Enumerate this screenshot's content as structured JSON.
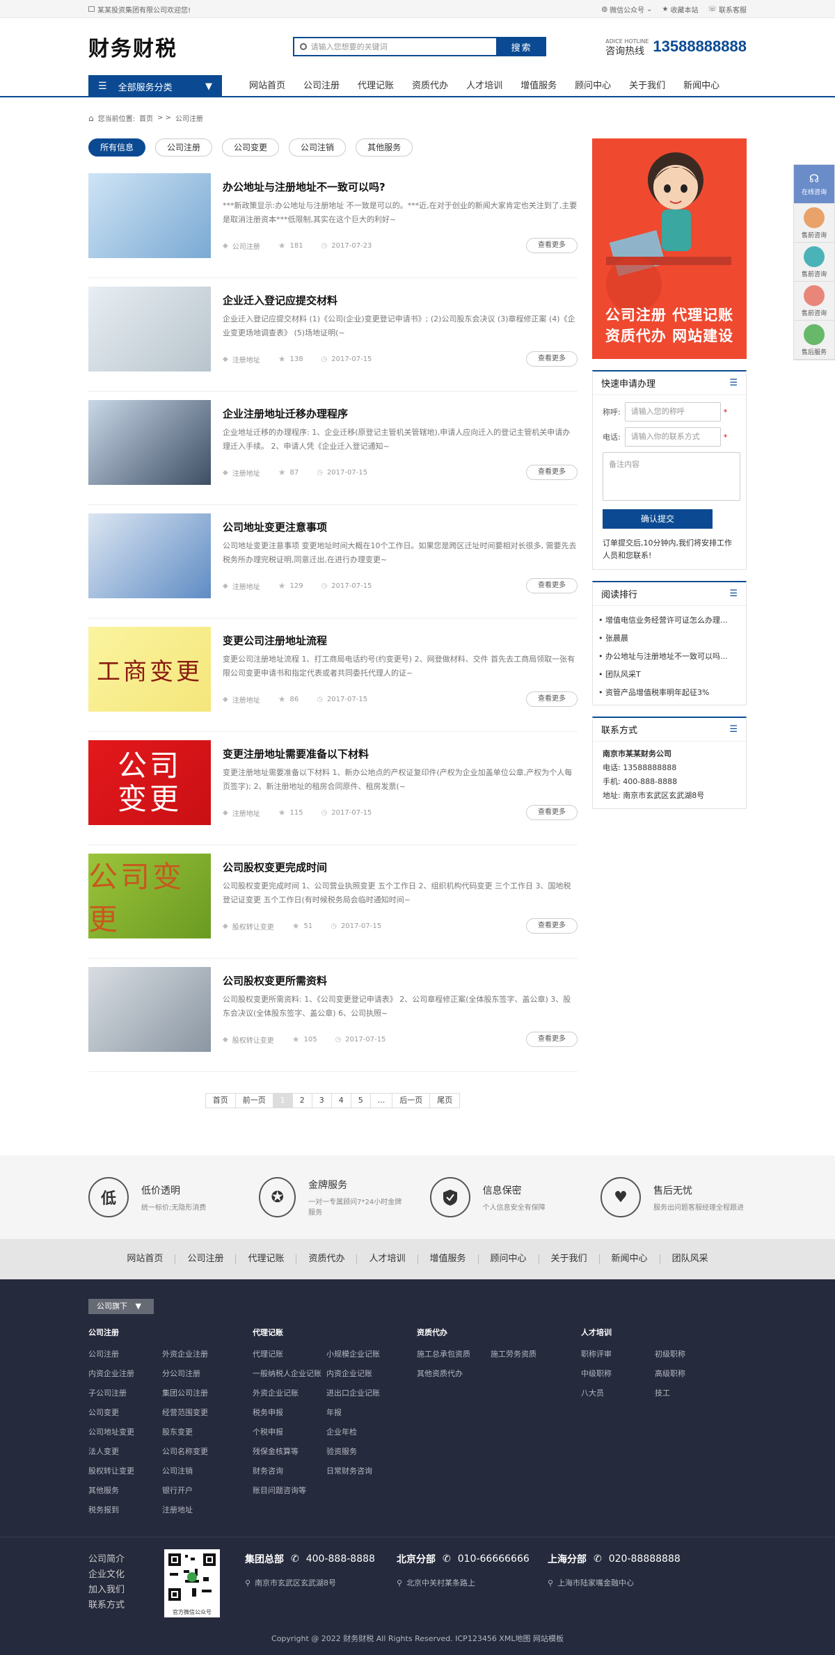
{
  "topbar": {
    "welcome": "某某投资集团有限公司欢迎您!",
    "wechat": "微信公众号",
    "favorite": "收藏本站",
    "service": "联系客服"
  },
  "header": {
    "logo": "财务财税",
    "search_placeholder": "请输入您想要的关键词",
    "search_button": "搜索",
    "hotline_en": "ADICE HOTLINE",
    "hotline_label": "咨询热线",
    "hotline_number": "13588888888"
  },
  "nav": {
    "all_categories": "全部服务分类",
    "items": [
      "网站首页",
      "公司注册",
      "代理记账",
      "资质代办",
      "人才培训",
      "增值服务",
      "顾问中心",
      "关于我们",
      "新闻中心"
    ]
  },
  "breadcrumb": {
    "label": "您当前位置:",
    "home": "首页",
    "sep": "> >",
    "current": "公司注册"
  },
  "filters": [
    "所有信息",
    "公司注册",
    "公司变更",
    "公司注销",
    "其他服务"
  ],
  "articles": [
    {
      "title": "办公地址与注册地址不一致可以吗?",
      "summary": "***新政策显示:办公地址与注册地址 不一致是可以的。***近,在对于创业的新闻大家肯定也关注到了,主要是取消注册资本***低限制,其实在这个巨大的利好~",
      "category": "公司注册",
      "views": "181",
      "date": "2017-07-23",
      "more": "查看更多"
    },
    {
      "title": "企业迁入登记应提交材料",
      "summary": "企业迁入登记应提交材料 (1)《公司(企业)变更登记申请书》; (2)公司股东会决议 (3)章程修正案 (4)《企业变更场地调查表》 (5)场地证明(~",
      "category": "注册地址",
      "views": "138",
      "date": "2017-07-15",
      "more": "查看更多"
    },
    {
      "title": "企业注册地址迁移办理程序",
      "summary": "企业地址迁移的办理程序: 1、企业迁移(原登记主管机关管辖地),申请人应向迁入的登记主管机关申请办理迁入手续。 2、申请人凭《企业迁入登记通知~",
      "category": "注册地址",
      "views": "87",
      "date": "2017-07-15",
      "more": "查看更多"
    },
    {
      "title": "公司地址变更注意事项",
      "summary": "公司地址变更注意事项 变更地址时间大概在10个工作日。如果您是跨区迁址时间要相对长很多, 需要先去税务所办理完税证明,同意迁出,在进行办理变更~",
      "category": "注册地址",
      "views": "129",
      "date": "2017-07-15",
      "more": "查看更多"
    },
    {
      "title": "变更公司注册地址流程",
      "summary": "变更公司注册地址流程 1、打工商局电话约号(约变更号) 2、网登做材料、交件 首先去工商局领取一张有限公司变更申请书和指定代表或者共同委托代理人的证~",
      "category": "注册地址",
      "views": "86",
      "date": "2017-07-15",
      "more": "查看更多"
    },
    {
      "title": "变更注册地址需要准备以下材料",
      "summary": "变更注册地址需要准备以下材料 1、新办公地点的产权证复印件(产权为企业加盖单位公章,产权为个人每页签字); 2、新注册地址的租房合同原件、租房发票(~",
      "category": "注册地址",
      "views": "115",
      "date": "2017-07-15",
      "more": "查看更多"
    },
    {
      "title": "公司股权变更完成时间",
      "summary": "公司股权变更完成时间 1、公司营业执照变更 五个工作日 2、组织机构代码变更 三个工作日 3、国地税登记证变更 五个工作日(有时候税务局会临时通知时间~",
      "category": "股权转让变更",
      "views": "51",
      "date": "2017-07-15",
      "more": "查看更多"
    },
    {
      "title": "公司股权变更所需资料",
      "summary": "公司股权变更所需资料: 1、《公司变更登记申请表》 2、公司章程修正案(全体股东签字、盖公章) 3、股东会决议(全体股东签字、盖公章) 6、公司执照~",
      "category": "股权转让变更",
      "views": "105",
      "date": "2017-07-15",
      "more": "查看更多"
    }
  ],
  "thumbs": [
    {
      "text": ""
    },
    {
      "text": ""
    },
    {
      "text": ""
    },
    {
      "text": ""
    },
    {
      "text": "工商变更"
    },
    {
      "text": "公司变更"
    },
    {
      "text": "公司变更"
    },
    {
      "text": ""
    }
  ],
  "pager": [
    "首页",
    "前一页",
    "1",
    "2",
    "3",
    "4",
    "5",
    "...",
    "后一页",
    "尾页"
  ],
  "sidebar": {
    "ad_line1": "公司注册 代理记账",
    "ad_line2": "资质代办 网站建设",
    "apply": {
      "title": "快速申请办理",
      "name_label": "称呼:",
      "name_placeholder": "请输入您的称呼",
      "phone_label": "电话:",
      "phone_placeholder": "请输入你的联系方式",
      "note_placeholder": "备注内容",
      "submit": "确认提交",
      "notice": "订单提交后,10分钟内,我们将安排工作人员和您联系!"
    },
    "rank": {
      "title": "阅读排行",
      "items": [
        "增值电信业务经营许可证怎么办理...",
        "张晨晨",
        "办公地址与注册地址不一致可以吗...",
        "团队风采T",
        "资管产品增值税率明年起征3%"
      ]
    },
    "contact": {
      "title": "联系方式",
      "company": "南京市某某财务公司",
      "phone_label": "电话:",
      "phone": "13588888888",
      "mobile_label": "手机:",
      "mobile": "400-888-8888",
      "addr_label": "地址:",
      "addr": "南京市玄武区玄武湖8号"
    }
  },
  "float": [
    "在线咨询",
    "售前咨询",
    "售前咨询",
    "售前咨询",
    "售后服务"
  ],
  "services": [
    {
      "icon": "低",
      "t1": "低价透明",
      "t2": "统一标价;无隐形消费"
    },
    {
      "icon": "",
      "t1": "金牌服务",
      "t2": "一对一专属顾问7*24小时金牌服务"
    },
    {
      "icon": "",
      "t1": "信息保密",
      "t2": "个人信息安全有保障"
    },
    {
      "icon": "",
      "t1": "售后无忧",
      "t2": "服务出问题客服经理全程跟进"
    }
  ],
  "footer_nav": [
    "网站首页",
    "公司注册",
    "代理记账",
    "资质代办",
    "人才培训",
    "增值服务",
    "顾问中心",
    "关于我们",
    "新闻中心",
    "团队风采"
  ],
  "footer": {
    "tag": "公司旗下",
    "cols": [
      {
        "title": "公司注册",
        "items": [
          "公司注册",
          "外资企业注册",
          "内资企业注册",
          "分公司注册",
          "子公司注册",
          "集团公司注册",
          "公司变更",
          "经营范围变更",
          "公司地址变更",
          "股东变更",
          "法人变更",
          "公司名称变更",
          "股权转让变更",
          "公司注销",
          "其他服务",
          "银行开户",
          "税务报到",
          "注册地址"
        ]
      },
      {
        "title": "代理记账",
        "items": [
          "代理记账",
          "小规模企业记账",
          "一般纳税人企业记账",
          "内资企业记账",
          "外资企业记账",
          "进出口企业记账",
          "税务申报",
          "年报",
          "个税申报",
          "企业年检",
          "残保金核算等",
          "验资服务",
          "财务咨询",
          "日常财务咨询",
          "账目问题咨询等"
        ]
      },
      {
        "title": "资质代办",
        "items": [
          "施工总承包资质",
          "施工劳务资质",
          "其他资质代办"
        ]
      },
      {
        "title": "人才培训",
        "items": [
          "职称评审",
          "初级职称",
          "中级职称",
          "高级职称",
          "八大员",
          "技工"
        ]
      }
    ],
    "links": [
      "公司简介",
      "企业文化",
      "加入我们",
      "联系方式"
    ],
    "qr_label": "官方微信公众号",
    "branches": [
      {
        "name": "集团总部",
        "phone": "400-888-8888",
        "addr": "南京市玄武区玄武湖8号"
      },
      {
        "name": "北京分部",
        "phone": "010-66666666",
        "addr": "北京中关村某条路上"
      },
      {
        "name": "上海分部",
        "phone": "020-88888888",
        "addr": "上海市陆家嘴金融中心"
      }
    ],
    "copyright": "Copyright @ 2022 财务财税 All Rights Reserved.   ICP123456   XML地图   网站模板"
  }
}
